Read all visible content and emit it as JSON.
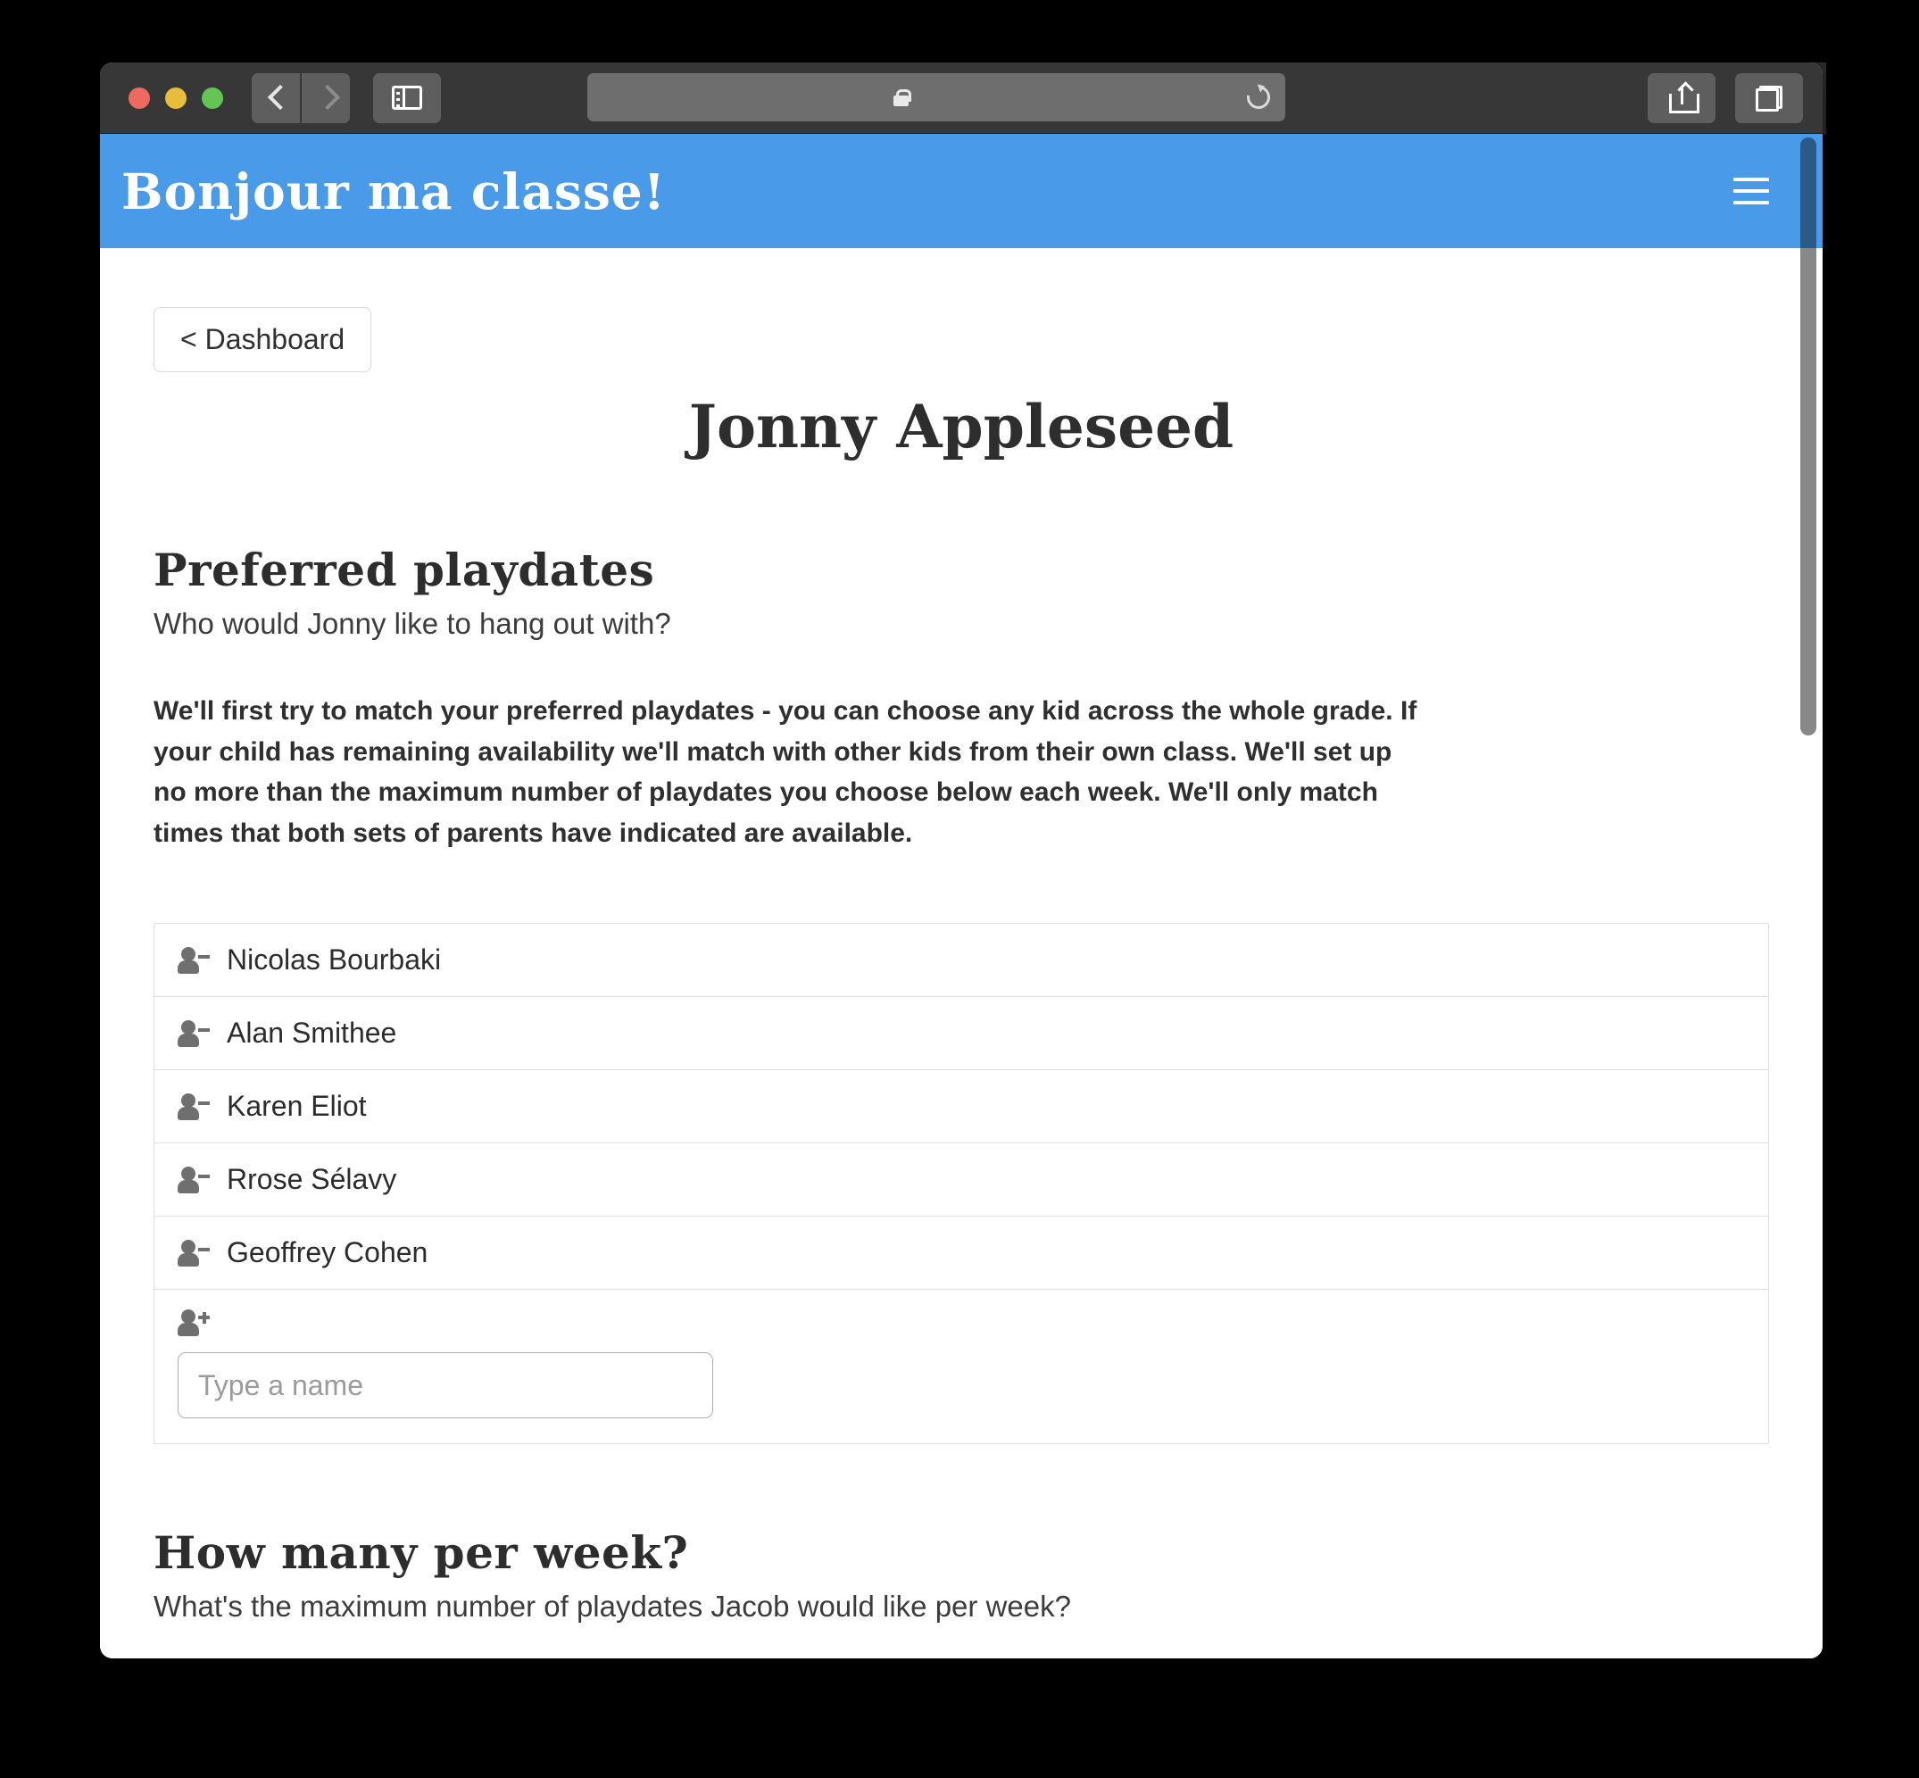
{
  "browser": {
    "traffic_lights": [
      "close",
      "minimize",
      "maximize"
    ],
    "back_label": "",
    "forward_label": "",
    "sidebar_label": "",
    "url_value": "",
    "url_placeholder": "",
    "reload_label": "",
    "share_label": "",
    "tab_overview_label": "",
    "new_tab_label": ""
  },
  "site": {
    "title": "Bonjour ma classe!",
    "header_color": "#4a9aea",
    "menu_label": ""
  },
  "content": {
    "back_button": "< Dashboard",
    "student_name": "Jonny Appleseed",
    "sections": [
      {
        "heading": "Preferred playdates",
        "subheading": "Who would Jonny like to hang out with?",
        "body": "We'll first try to match your preferred playdates - you can choose any kid across the whole grade. If your child has remaining availability we'll match with other kids from their own class. We'll set up no more than the maximum number of playdates you choose below each week. We'll only match times that both sets of parents have indicated are available."
      },
      {
        "heading": "How many per week?",
        "subheading": "What's the maximum number of playdates Jacob would like per week?"
      }
    ],
    "playdates": [
      {
        "name": "Nicolas Bourbaki",
        "icon": "person-remove-icon"
      },
      {
        "name": "Alan Smithee",
        "icon": "person-remove-icon"
      },
      {
        "name": "Karen Eliot",
        "icon": "person-remove-icon"
      },
      {
        "name": "Rrose Sélavy",
        "icon": "person-remove-icon"
      },
      {
        "name": "Geoffrey Cohen",
        "icon": "person-remove-icon"
      }
    ],
    "add_row": {
      "icon": "person-add-icon",
      "input_value": "",
      "input_placeholder": "Type a name"
    }
  }
}
